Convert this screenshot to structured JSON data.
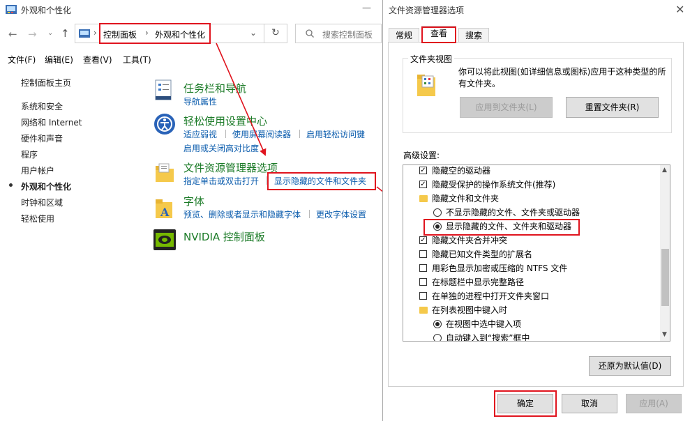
{
  "control_panel": {
    "title": "外观和个性化",
    "breadcrumb": [
      "控制面板",
      "外观和个性化"
    ],
    "search_placeholder": "搜索控制面板",
    "menu": [
      "文件(F)",
      "编辑(E)",
      "查看(V)",
      "工具(T)"
    ],
    "nav": {
      "home": "控制面板主页",
      "items": [
        "系统和安全",
        "网络和 Internet",
        "硬件和声音",
        "程序",
        "用户帐户",
        "外观和个性化",
        "时钟和区域",
        "轻松使用"
      ],
      "active_index": 5
    },
    "categories": [
      {
        "title": "任务栏和导航",
        "links": [
          "导航属性"
        ]
      },
      {
        "title": "轻松使用设置中心",
        "links": [
          "适应弱视",
          "使用屏幕阅读器",
          "启用轻松访问键",
          "启用或关闭高对比度"
        ]
      },
      {
        "title": "文件资源管理器选项",
        "links": [
          "指定单击或双击打开",
          "显示隐藏的文件和文件夹"
        ]
      },
      {
        "title": "字体",
        "links": [
          "预览、删除或者显示和隐藏字体",
          "更改字体设置"
        ]
      },
      {
        "title": "NVIDIA 控制面板",
        "links": []
      }
    ]
  },
  "dialog": {
    "title": "文件资源管理器选项",
    "tabs": [
      "常规",
      "查看",
      "搜索"
    ],
    "active_tab": 1,
    "folder_views": {
      "label": "文件夹视图",
      "description": "你可以将此视图(如详细信息或图标)应用于这种类型的所有文件夹。",
      "apply_button": "应用到文件夹(L)",
      "reset_button": "重置文件夹(R)"
    },
    "advanced_label": "高级设置:",
    "advanced_items": [
      {
        "type": "checkbox",
        "label": "隐藏空的驱动器",
        "checked": true,
        "indent": 0
      },
      {
        "type": "checkbox",
        "label": "隐藏受保护的操作系统文件(推荐)",
        "checked": true,
        "indent": 0
      },
      {
        "type": "folder",
        "label": "隐藏文件和文件夹",
        "indent": 0
      },
      {
        "type": "radio",
        "label": "不显示隐藏的文件、文件夹或驱动器",
        "checked": false,
        "indent": 1
      },
      {
        "type": "radio",
        "label": "显示隐藏的文件、文件夹和驱动器",
        "checked": true,
        "indent": 1
      },
      {
        "type": "checkbox",
        "label": "隐藏文件夹合并冲突",
        "checked": true,
        "indent": 0
      },
      {
        "type": "checkbox",
        "label": "隐藏已知文件类型的扩展名",
        "checked": false,
        "indent": 0
      },
      {
        "type": "checkbox",
        "label": "用彩色显示加密或压缩的 NTFS 文件",
        "checked": false,
        "indent": 0
      },
      {
        "type": "checkbox",
        "label": "在标题栏中显示完整路径",
        "checked": false,
        "indent": 0
      },
      {
        "type": "checkbox",
        "label": "在单独的进程中打开文件夹窗口",
        "checked": false,
        "indent": 0
      },
      {
        "type": "folder",
        "label": "在列表视图中键入时",
        "indent": 0
      },
      {
        "type": "radio",
        "label": "在视图中选中键入项",
        "checked": true,
        "indent": 1
      },
      {
        "type": "radio",
        "label": "自动键入到“搜索”框中",
        "checked": false,
        "indent": 1
      }
    ],
    "restore_button": "还原为默认值(D)",
    "ok_button": "确定",
    "cancel_button": "取消",
    "apply_button": "应用(A)"
  },
  "colors": {
    "highlight": "#e0141e",
    "link": "#0b5cad",
    "category": "#1a7a26"
  }
}
